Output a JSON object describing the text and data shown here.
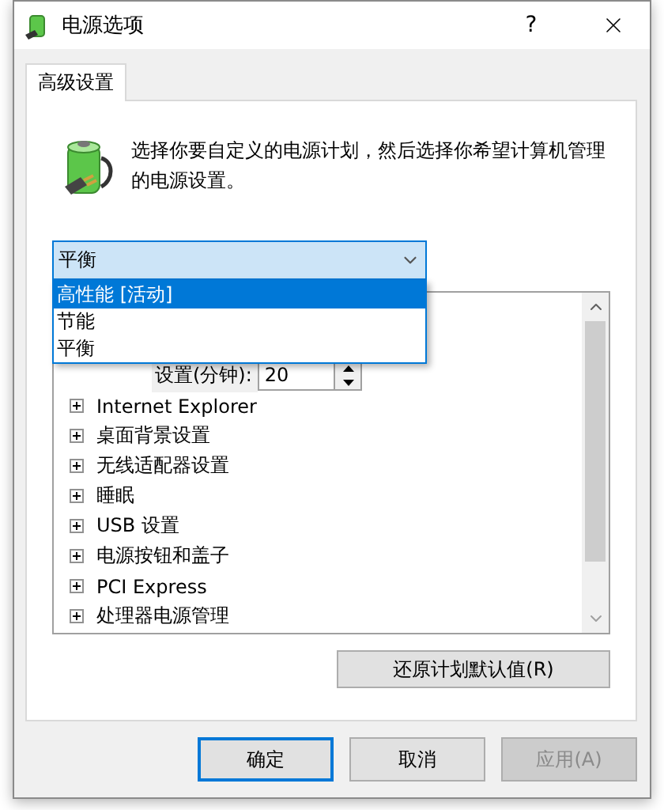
{
  "window": {
    "title": "电源选项",
    "help": "?"
  },
  "tabs": [
    {
      "label": "高级设置",
      "selected": true
    }
  ],
  "description": "选择你要自定义的电源计划，然后选择你希望计算机管理的电源设置。",
  "plan_select": {
    "value": "平衡",
    "expanded": true,
    "options": [
      {
        "label": "高性能 [活动]",
        "highlighted": true
      },
      {
        "label": "节能",
        "highlighted": false
      },
      {
        "label": "平衡",
        "highlighted": false
      }
    ]
  },
  "setting": {
    "label": "设置(分钟):",
    "value": "20"
  },
  "tree": [
    {
      "label": "Internet Explorer",
      "expanded": false
    },
    {
      "label": "桌面背景设置",
      "expanded": false
    },
    {
      "label": "无线适配器设置",
      "expanded": false
    },
    {
      "label": "睡眠",
      "expanded": false
    },
    {
      "label": "USB 设置",
      "expanded": false
    },
    {
      "label": "电源按钮和盖子",
      "expanded": false
    },
    {
      "label": "PCI Express",
      "expanded": false
    },
    {
      "label": "处理器电源管理",
      "expanded": false
    }
  ],
  "restore_button": "还原计划默认值(R)",
  "buttons": [
    {
      "label": "确定",
      "default": true,
      "disabled": false
    },
    {
      "label": "取消",
      "default": false,
      "disabled": false
    },
    {
      "label": "应用(A)",
      "default": false,
      "disabled": true
    }
  ]
}
